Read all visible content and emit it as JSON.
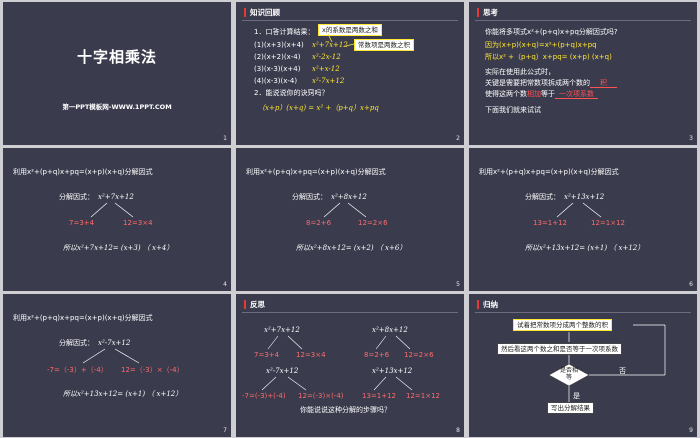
{
  "colors": {
    "slide_bg": "#3a3b4d",
    "accent_red": "#e53935",
    "highlight_yellow": "#ffe733",
    "result_red": "#ff6b6b"
  },
  "slides": [
    {
      "number": "1",
      "title": "十字相乘法",
      "subtitle": "第一PPT模板网-WWW.1PPT.COM"
    },
    {
      "number": "2",
      "header": "知识回顾",
      "item1_label": "1．口答计算结果：",
      "lines": [
        "(1)(x+3)(x+4)",
        "(2)(x+2)(x-4)",
        "(3)(x-3)(x+4)",
        "(4)(x-3)(x-4)"
      ],
      "answers": [
        "x²+7x+12",
        "x²-2x-12",
        "x²+x-12",
        "x²-7x+12"
      ],
      "note_top": "x的系数是两数之和",
      "note_mid": "常数项是两数之积",
      "item2_label": "2．能说说你的诀窍吗？",
      "formula": "（x+p）(x+q) = x² +（p+q）x+pq"
    },
    {
      "number": "3",
      "header": "思考",
      "q": "你能将多项式x²+(p+q)x+pq分解因式吗?",
      "because": "因为(x+p)(x+q)=x²+(p+q)x+pq",
      "so": "所以x² +（p+q）x+pq= (x+p) (x+q)",
      "p1": "实际在使用此公式时，",
      "p2a": "关键是需要把常数项拆成两个数的",
      "p2b": "积",
      "p3a": "使得这两个数",
      "p3b": "相加",
      "p3c": "等于",
      "p3d": "一次项系数",
      "p4": "下面我们就来试试"
    },
    {
      "number": "4",
      "top": "利用x²+(p+q)x+pq=(x+p)(x+q)分解因式",
      "label": "分解因式：",
      "expr": "x²+7x+12",
      "left": "7=3+4",
      "right": "12=3×4",
      "result": "所以x²+7x+12= (x+3)  （ x+4）"
    },
    {
      "number": "5",
      "top": "利用x²+(p+q)x+pq=(x+p)(x+q)分解因式",
      "label": "分解因式：",
      "expr": "x²+8x+12",
      "left": "8=2+6",
      "right": "12=2×6",
      "result": "所以x²+8x+12= (x+2)  （ x+6）"
    },
    {
      "number": "6",
      "top": "利用x²+(p+q)x+pq=(x+p)(x+q)分解因式",
      "label": "分解因式：",
      "expr": "x²+13x+12",
      "left": "13=1+12",
      "right": "12=1×12",
      "result": "所以x²+13x+12= (x+1)  （ x+12）"
    },
    {
      "number": "7",
      "top": "利用x²+(p+q)x+pq=(x+p)(x+q)分解因式",
      "label": "分解因式：",
      "expr": "x²-7x+12",
      "left": "-7=（-3）+（-4）",
      "right": "12=（-3）×（-4）",
      "result": "所以x²+13x+12= (x+1)  （ x+12）"
    },
    {
      "number": "8",
      "header": "反思",
      "exprs": [
        "x²+7x+12",
        "x²+8x+12",
        "x²-7x+12",
        "x²+13x+12"
      ],
      "lefts": [
        "7=3+4",
        "8=2+6",
        "-7=(-3)+(-4)",
        "13=1+12"
      ],
      "rights": [
        "12=3×4",
        "12=2×6",
        "12=(-3)×(-4)",
        "12=1×12"
      ],
      "question": "你能说说这种分解的步骤吗？"
    },
    {
      "number": "9",
      "header": "归纳",
      "step1": "试着把常数项分成两个整数的积",
      "step2": "然后看这两个数之和是否等于一次项系数",
      "decision": "是否相等",
      "no": "否",
      "yes": "是",
      "step3": "写出分解结果"
    }
  ]
}
